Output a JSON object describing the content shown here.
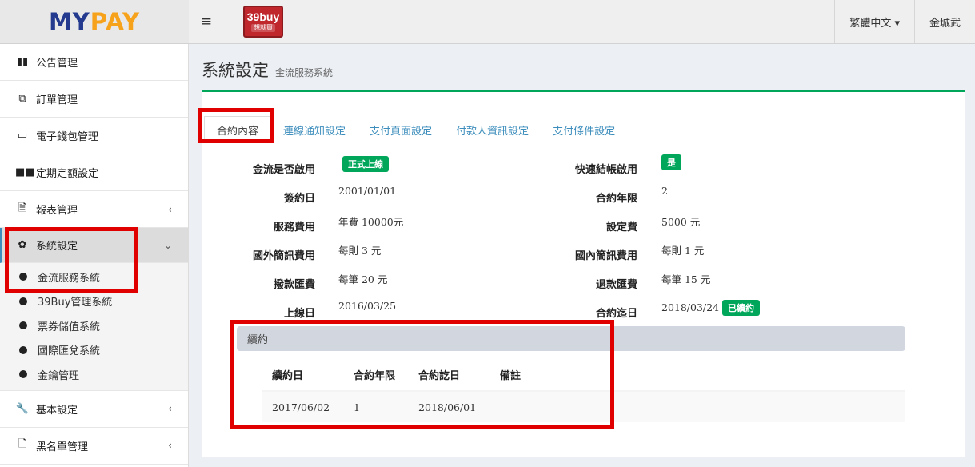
{
  "header": {
    "logo_my": "MY",
    "logo_pay": "PAY",
    "menu_icon": "hamburger-icon",
    "brand_badge": {
      "big": "39buy",
      "small": "想就買"
    },
    "language": "繁體中文 ▾",
    "user": "金城武"
  },
  "sidebar": {
    "items": [
      {
        "icon": "map-icon",
        "glyph": "▮▮",
        "label": "公告管理"
      },
      {
        "icon": "copy-icon",
        "glyph": "⧉",
        "label": "訂單管理"
      },
      {
        "icon": "credit-card-icon",
        "glyph": "▭",
        "label": "電子錢包管理"
      },
      {
        "icon": "grid-icon",
        "glyph": "■■",
        "label": "定期定額設定"
      },
      {
        "icon": "file-icon",
        "glyph": "🗎",
        "label": "報表管理",
        "chevron": "‹"
      },
      {
        "icon": "gear-icon",
        "glyph": "✿",
        "label": "系統設定",
        "chevron": "⌄"
      },
      {
        "icon": "wrench-icon",
        "glyph": "🔧",
        "label": "基本設定",
        "chevron": "‹"
      },
      {
        "icon": "document-icon",
        "glyph": "🗋",
        "label": "黑名單管理",
        "chevron": "‹"
      }
    ],
    "submenu": [
      "金流服務系統",
      "39Buy管理系統",
      "票券儲值系統",
      "國際匯兌系統",
      "金鑰管理"
    ]
  },
  "content_header": {
    "title": "系統設定",
    "subtitle": "金流服務系統"
  },
  "tabs": [
    "合約內容",
    "連線通知設定",
    "支付頁面設定",
    "付款人資訊設定",
    "支付條件設定"
  ],
  "contract": {
    "left": [
      {
        "label": "金流是否啟用",
        "value": "",
        "badge": "正式上線"
      },
      {
        "label": "簽約日",
        "value": "2001/01/01"
      },
      {
        "label": "服務費用",
        "value": "年費 10000元"
      },
      {
        "label": "國外簡訊費用",
        "value": "每則 3 元"
      },
      {
        "label": "撥款匯費",
        "value": "每筆 20 元"
      },
      {
        "label": "上線日",
        "value": "2016/03/25"
      }
    ],
    "right": [
      {
        "label": "快速結帳啟用",
        "value": "",
        "badge": "是"
      },
      {
        "label": "合約年限",
        "value": "2"
      },
      {
        "label": "設定費",
        "value": "5000 元"
      },
      {
        "label": "國內簡訊費用",
        "value": "每則  1  元"
      },
      {
        "label": "退款匯費",
        "value": "每筆 15 元"
      },
      {
        "label": "合約迄日",
        "value": "2018/03/24",
        "badge": "已續約"
      }
    ]
  },
  "renewal": {
    "title": "續約",
    "columns": [
      "續約日",
      "合約年限",
      "合約訖日",
      "備註"
    ],
    "rows": [
      [
        "2017/06/02",
        "1",
        "2018/06/01",
        ""
      ]
    ]
  }
}
